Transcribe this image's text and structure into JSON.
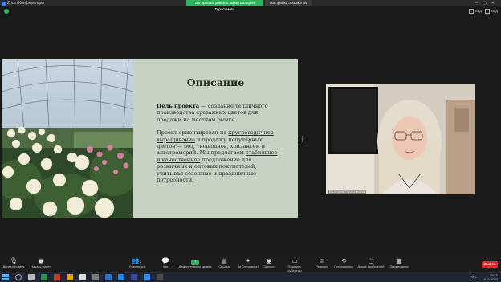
{
  "window": {
    "app_title": "Zoom Конференция",
    "share_notice": "Вы просматриваете экран Валерия Герасимова",
    "view_settings": "Настройки просмотра",
    "top_right_1": "Вид",
    "top_right_2": "Вид"
  },
  "slide": {
    "title": "Описание",
    "goal_heading": "Цель проекта",
    "goal_text": " — создание тепличного производства срезанных цветов для продажи на местном рынке.",
    "p2_a": "Проект ориентирован на ",
    "p2_link1": "круглогодичное выращивание",
    "p2_b": " и продажу популярных цветов — роз, тюльпанов, хризантем и альстромерий. Мы предлагаем ",
    "p2_link2": "стабильное и качественное",
    "p2_c": " предложение для розничных и оптовых покупателей, учитывая сезонные и праздничные потребности."
  },
  "participant": {
    "name": "Валерия Герасимова"
  },
  "toolbar": {
    "mic": "Включить звук",
    "video": "Начать видео",
    "participants": "Участники",
    "participants_count": "2",
    "chat": "Чат",
    "share": "Демонстрация экрана",
    "summary": "Сводка",
    "companion": "AI Companion",
    "record": "Запись",
    "captions": "Показать субтитры",
    "reactions": "Реакции",
    "apps": "Приложения",
    "waiting": "Доска сообщений",
    "notes": "Примечания",
    "leave": "Выйти"
  },
  "taskbar": {
    "lang": "РУС",
    "time": "15:21",
    "date": "18.11.2024"
  },
  "colors": {
    "slide_bg": "#c7d1c4",
    "share_green": "#2fb35a",
    "leave_red": "#e02828"
  }
}
